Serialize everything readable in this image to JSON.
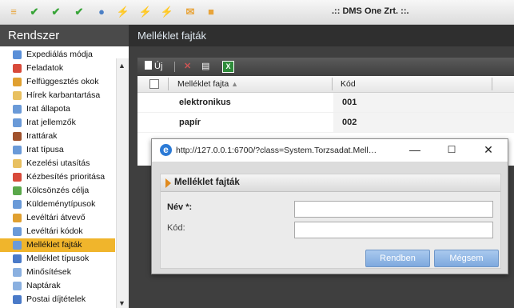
{
  "toolbar": {
    "icons": [
      {
        "name": "menu-icon",
        "glyph": "≡",
        "color": "#e8a43a"
      },
      {
        "name": "check-icon",
        "glyph": "✔",
        "color": "#39a539"
      },
      {
        "name": "double-check-icon",
        "glyph": "✔",
        "color": "#39a539"
      },
      {
        "name": "document-check-icon",
        "glyph": "✔",
        "color": "#39a539"
      },
      {
        "name": "users-icon",
        "glyph": "●",
        "color": "#4b7fc5"
      },
      {
        "name": "green-lightning-icon",
        "glyph": "⚡",
        "color": "#2aa83c"
      },
      {
        "name": "blue-lightning-icon",
        "glyph": "⚡",
        "color": "#2a6fd0"
      },
      {
        "name": "red-lightning-icon",
        "glyph": "⚡",
        "color": "#d8402b"
      },
      {
        "name": "mail-icon",
        "glyph": "✉",
        "color": "#e8a43a"
      },
      {
        "name": "folder-icon",
        "glyph": "■",
        "color": "#e8a43a"
      }
    ],
    "brand": ".:: DMS One Zrt. ::."
  },
  "sidebar": {
    "title": "Rendszer",
    "items": [
      {
        "label": "Expediálás módja",
        "icon": "expedition-icon",
        "color": "#5a8fd8"
      },
      {
        "label": "Feladatok",
        "icon": "tasks-icon",
        "color": "#d84a3a"
      },
      {
        "label": "Felfüggesztés okok",
        "icon": "suspend-icon",
        "color": "#e0a030"
      },
      {
        "label": "Hírek karbantartása",
        "icon": "news-icon",
        "color": "#e8c060"
      },
      {
        "label": "Irat állapota",
        "icon": "document-status-icon",
        "color": "#6a9ad8"
      },
      {
        "label": "Irat jellemzők",
        "icon": "document-props-icon",
        "color": "#6a9ad8"
      },
      {
        "label": "Irattárak",
        "icon": "archive-icon",
        "color": "#a0522d"
      },
      {
        "label": "Irat típusa",
        "icon": "document-type-icon",
        "color": "#6a9ad8"
      },
      {
        "label": "Kezelési utasítás",
        "icon": "instruction-icon",
        "color": "#e8c060"
      },
      {
        "label": "Kézbesítés prioritása",
        "icon": "priority-icon",
        "color": "#d84a3a"
      },
      {
        "label": "Kölcsönzés célja",
        "icon": "loan-icon",
        "color": "#5aa84a"
      },
      {
        "label": "Küldeménytípusok",
        "icon": "shipment-icon",
        "color": "#6a9ad8"
      },
      {
        "label": "Levéltári átvevő",
        "icon": "archive-receiver-icon",
        "color": "#e0a030"
      },
      {
        "label": "Levéltári kódok",
        "icon": "archive-codes-icon",
        "color": "#6a9ad8"
      },
      {
        "label": "Melléklet fajták",
        "icon": "attachment-kinds-icon",
        "color": "#6a9ad8",
        "active": true
      },
      {
        "label": "Melléklet típusok",
        "icon": "attachment-types-icon",
        "color": "#4a7ac8"
      },
      {
        "label": "Minősítések",
        "icon": "classification-icon",
        "color": "#8ab0e0"
      },
      {
        "label": "Naptárak",
        "icon": "calendar-icon",
        "color": "#8ab0e0"
      },
      {
        "label": "Postai díjtételek",
        "icon": "postal-fee-icon",
        "color": "#4a7ac8"
      }
    ]
  },
  "main": {
    "title": "Melléklet fajták",
    "grid_toolbar": {
      "new_label": "Új"
    },
    "columns": [
      "Melléklet fajta",
      "Kód"
    ],
    "rows": [
      {
        "fajta": "elektronikus",
        "kod": "001"
      },
      {
        "fajta": "papír",
        "kod": "002"
      }
    ]
  },
  "popup": {
    "url": "http://127.0.0.1:6700/?class=System.Torzsadat.Mell…",
    "form_title": "Melléklet fajták",
    "name_label": "Név *:",
    "name_value": "",
    "code_label": "Kód:",
    "code_value": "",
    "ok_label": "Rendben",
    "cancel_label": "Mégsem"
  }
}
